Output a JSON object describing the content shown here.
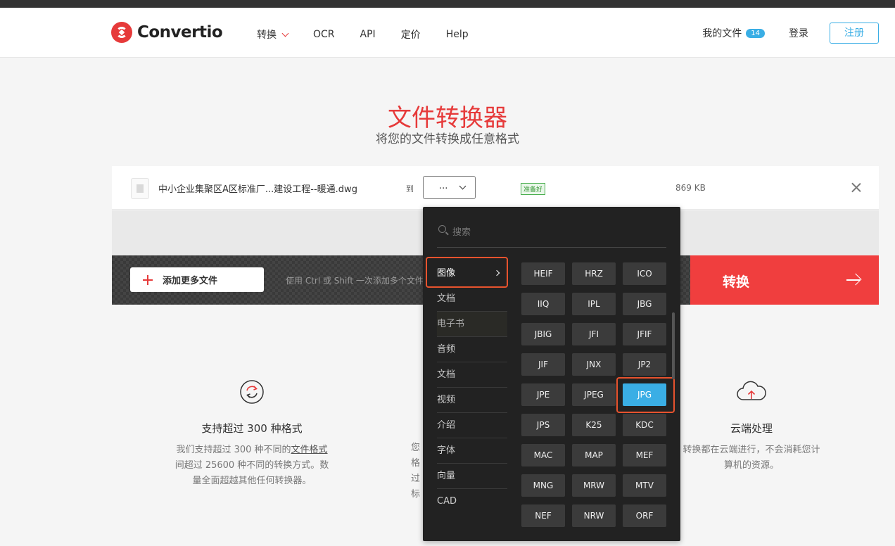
{
  "brand": {
    "name": "Convertio",
    "color": "#e63a3a",
    "accent": "#3aaee5"
  },
  "nav": {
    "items": [
      "转换",
      "OCR",
      "API",
      "定价",
      "Help"
    ]
  },
  "header_right": {
    "my_files": "我的文件",
    "files_count": "14",
    "login": "登录",
    "register": "注册"
  },
  "hero": {
    "title": "文件转换器",
    "subtitle": "将您的文件转换成任意格式"
  },
  "file": {
    "name": "中小企业集聚区A区标准厂...建设工程--暖通.dwg",
    "to_label": "到",
    "format_value": "...",
    "status": "准备好",
    "size": "869 KB"
  },
  "actions": {
    "add_files": "添加更多文件",
    "hint": "使用 Ctrl 或 Shift 一次添加多个文件",
    "convert": "转换"
  },
  "dropdown": {
    "search_placeholder": "搜索",
    "categories": [
      "图像",
      "文档",
      "电子书",
      "音频",
      "文档",
      "视频",
      "介绍",
      "字体",
      "向量",
      "CAD"
    ],
    "active_category": "图像",
    "formats": [
      "HEIF",
      "HRZ",
      "ICO",
      "IIQ",
      "IPL",
      "JBG",
      "JBIG",
      "JFI",
      "JFIF",
      "JIF",
      "JNX",
      "JP2",
      "JPE",
      "JPEG",
      "JPG",
      "JPS",
      "K25",
      "KDC",
      "MAC",
      "MAP",
      "MEF",
      "MNG",
      "MRW",
      "MTV",
      "NEF",
      "NRW",
      "ORF"
    ],
    "selected_format": "JPG"
  },
  "features": {
    "f1": {
      "icon": "refresh-icon",
      "title": "支持超过 300 种格式",
      "line1_prefix": "我们支持超过 300 种不同的",
      "line1_link": "文件格式",
      "line2": "间超过 25600 种不同的转换方式。数",
      "line3": "量全面超越其他任何转换器。"
    },
    "f2": {
      "l1": "您",
      "l2": "格",
      "l3": "过",
      "l4": "标"
    },
    "f3": {
      "icon": "cloud-upload-icon",
      "title": "云端处理",
      "line1": "转换都在云端进行，不会消耗您计",
      "line2": "算机的资源。"
    }
  }
}
